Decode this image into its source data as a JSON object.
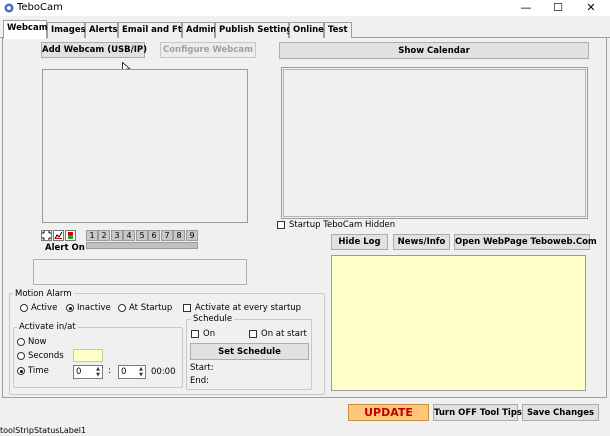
{
  "window": {
    "title": "TeboCam",
    "minimize": "—",
    "maximize": "☐",
    "close": "✕"
  },
  "tabs": [
    "Webcam",
    "Images",
    "Alerts",
    "Email and Ftp",
    "Admin",
    "Publish Settings",
    "Online",
    "Test"
  ],
  "webcam": {
    "add_webcam": "Add Webcam (USB/IP)",
    "configure_webcam": "Configure Webcam",
    "show_calendar": "Show Calendar",
    "startup_hidden": "Startup TeboCam Hidden",
    "hide_log": "Hide Log",
    "news_info": "News/Info",
    "open_webpage": "Open WebPage Teboweb.Com",
    "alert_on": "Alert On",
    "slots": [
      "1",
      "2",
      "3",
      "4",
      "5",
      "6",
      "7",
      "8",
      "9"
    ]
  },
  "motion_alarm": {
    "title": "Motion Alarm",
    "active": "Active",
    "inactive": "Inactive",
    "at_startup": "At Startup",
    "activate_every_startup": "Activate at every startup",
    "selected": "inactive"
  },
  "activate_in_at": {
    "title": "Activate in/at",
    "now": "Now",
    "seconds": "Seconds",
    "time": "Time",
    "hour": "0",
    "minute": "0",
    "colon": ":",
    "time_display": "00:00",
    "selected": "time"
  },
  "schedule": {
    "title": "Schedule",
    "on": "On",
    "on_at_start": "On at start",
    "set_schedule": "Set Schedule",
    "start": "Start:",
    "end": "End:"
  },
  "bottom": {
    "update": "UPDATE",
    "tooltips_off": "Turn OFF Tool Tips",
    "save_changes": "Save Changes"
  },
  "statusbar": {
    "label": "toolStripStatusLabel1"
  },
  "colors": {
    "log_bg": "#ffffc8",
    "update_bg": "#ffc77a",
    "update_fg": "#c00000"
  }
}
